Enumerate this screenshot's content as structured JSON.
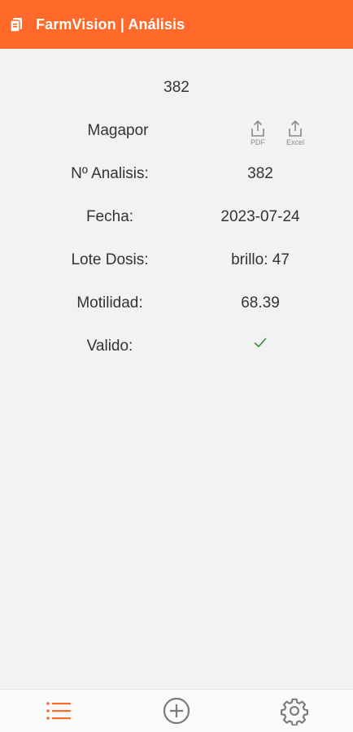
{
  "app": {
    "title": "FarmVision | Análisis",
    "accent": "#ff6a2b"
  },
  "analysis": {
    "header_number": "382",
    "company": "Magapor",
    "rows": [
      {
        "label": "Nº Analisis:",
        "value": "382"
      },
      {
        "label": "Fecha:",
        "value": "2023-07-24"
      },
      {
        "label": "Lote Dosis:",
        "value": "brillo: 47"
      },
      {
        "label": "Motilidad:",
        "value": "68.39"
      },
      {
        "label": "Valido:",
        "value_icon": "check-icon",
        "value_color": "#3a8a3a"
      }
    ]
  },
  "export": {
    "pdf_label": "PDF",
    "excel_label": "Excel",
    "icon": "share-upload-icon"
  },
  "bottom_nav": {
    "items": [
      {
        "name": "list",
        "icon": "list-icon",
        "active": true
      },
      {
        "name": "add",
        "icon": "add-circle-icon",
        "active": false
      },
      {
        "name": "settings",
        "icon": "gear-icon",
        "active": false
      }
    ]
  }
}
